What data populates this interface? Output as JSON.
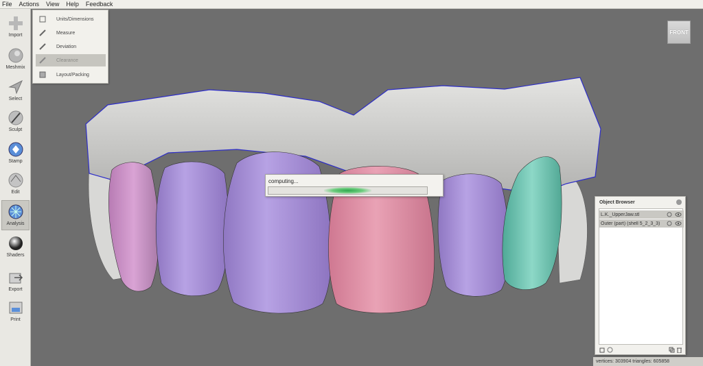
{
  "menu": [
    "File",
    "Actions",
    "View",
    "Help",
    "Feedback"
  ],
  "toolbar": [
    {
      "label": "Import",
      "icon": "plus-icon"
    },
    {
      "label": "Meshmix",
      "icon": "meshmix-icon"
    },
    {
      "label": "Select",
      "icon": "select-arrow-icon"
    },
    {
      "label": "Sculpt",
      "icon": "brush-icon"
    },
    {
      "label": "Stamp",
      "icon": "stamp-icon"
    },
    {
      "label": "Edit",
      "icon": "edit-icon"
    },
    {
      "label": "Analysis",
      "icon": "analysis-icon"
    },
    {
      "label": "Shaders",
      "icon": "shaders-sphere-icon"
    },
    {
      "label": "Export",
      "icon": "export-icon"
    },
    {
      "label": "Print",
      "icon": "print-icon"
    }
  ],
  "analysis_menu": [
    {
      "label": "Units/Dimensions",
      "icon": "units-icon"
    },
    {
      "label": "Measure",
      "icon": "ruler-icon"
    },
    {
      "label": "Deviation",
      "icon": "deviation-icon"
    },
    {
      "label": "Clearance",
      "icon": "clearance-icon"
    },
    {
      "label": "Layout/Packing",
      "icon": "packing-icon"
    }
  ],
  "viewcube": {
    "label": "FRONT"
  },
  "progress": {
    "text": "computing...",
    "value": 0.5
  },
  "object_browser": {
    "title": "Object Browser",
    "items": [
      {
        "name": "L.K._UpperJaw.stl"
      },
      {
        "name": "Outer (part) (shell 5_2_3_3)"
      }
    ]
  },
  "status": {
    "text": "vertices: 303904 triangles: 605858"
  },
  "colors": {
    "viewport_bg": "#6e6e6e",
    "gum": "#cfcfcd",
    "tooth_purple": "#a68fd6",
    "tooth_pink": "#dd8aa0",
    "tooth_magenta": "#c98fc5",
    "tooth_teal": "#6fc7b4",
    "boundary_line": "#1a1ac8",
    "progress_green": "#2fa84e"
  }
}
